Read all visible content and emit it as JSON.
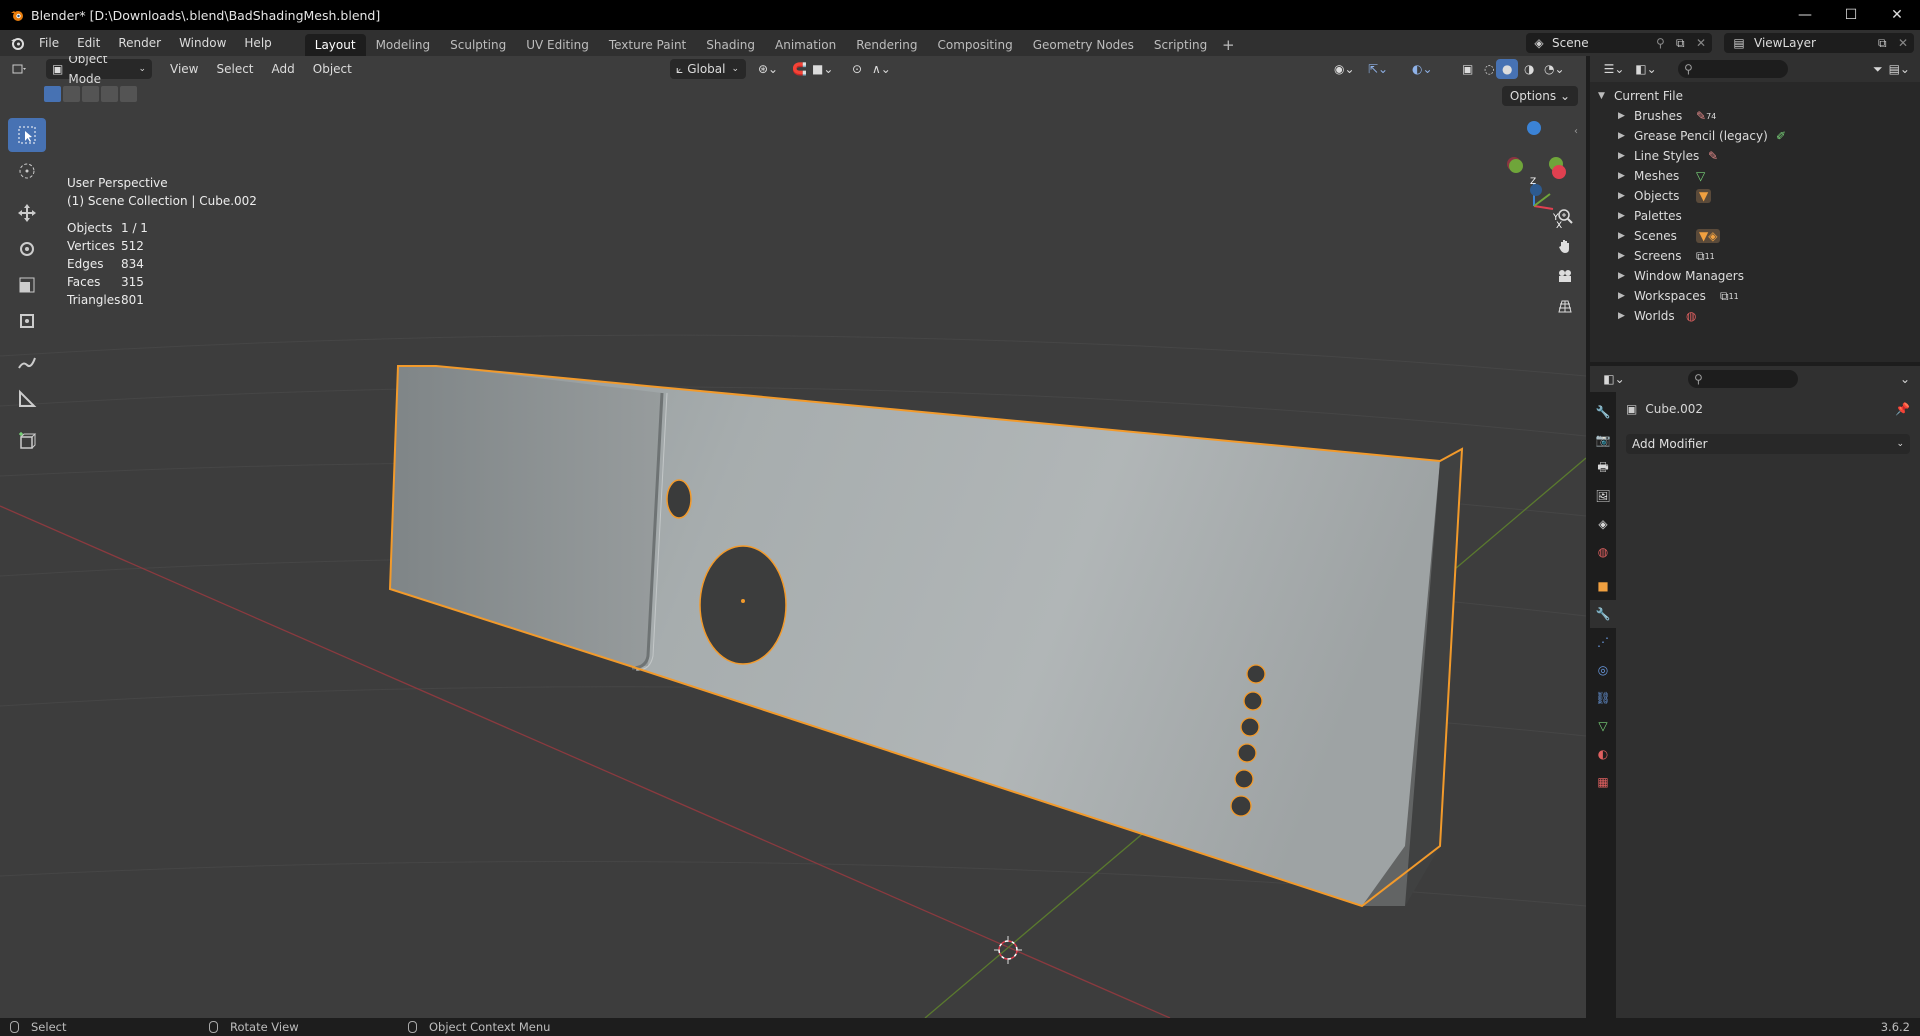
{
  "window": {
    "title": "Blender* [D:\\Downloads\\.blend\\BadShadingMesh.blend]",
    "minimize": "—",
    "maximize": "☐",
    "close": "✕"
  },
  "menu": [
    "File",
    "Edit",
    "Render",
    "Window",
    "Help"
  ],
  "workspaces": [
    "Layout",
    "Modeling",
    "Sculpting",
    "UV Editing",
    "Texture Paint",
    "Shading",
    "Animation",
    "Rendering",
    "Compositing",
    "Geometry Nodes",
    "Scripting"
  ],
  "active_workspace": "Layout",
  "scene_name": "Scene",
  "view_layer_name": "ViewLayer",
  "viewport": {
    "mode": "Object Mode",
    "menus": [
      "View",
      "Select",
      "Add",
      "Object"
    ],
    "transform_orientation": "Global",
    "options_label": "Options",
    "perspective_label": "User Perspective",
    "collection_label": "(1) Scene Collection | Cube.002",
    "stats": [
      {
        "label": "Objects",
        "value": "1 / 1"
      },
      {
        "label": "Vertices",
        "value": "512"
      },
      {
        "label": "Edges",
        "value": "834"
      },
      {
        "label": "Faces",
        "value": "315"
      },
      {
        "label": "Triangles",
        "value": "801"
      }
    ],
    "gizmo_axes": {
      "x": "X",
      "y": "Y",
      "z": "Z"
    }
  },
  "outliner": {
    "root": "Current File",
    "items": [
      {
        "label": "Brushes",
        "badge": "74"
      },
      {
        "label": "Grease Pencil (legacy)",
        "badge": ""
      },
      {
        "label": "Line Styles",
        "badge": ""
      },
      {
        "label": "Meshes",
        "badge": ""
      },
      {
        "label": "Objects",
        "badge": ""
      },
      {
        "label": "Palettes",
        "badge": ""
      },
      {
        "label": "Scenes",
        "badge": ""
      },
      {
        "label": "Screens",
        "badge": "11"
      },
      {
        "label": "Window Managers",
        "badge": ""
      },
      {
        "label": "Workspaces",
        "badge": "11"
      },
      {
        "label": "Worlds",
        "badge": ""
      }
    ]
  },
  "properties": {
    "object_name": "Cube.002",
    "add_modifier_label": "Add Modifier"
  },
  "statusbar": {
    "select": "Select",
    "rotate": "Rotate View",
    "context": "Object Context Menu",
    "version": "3.6.2"
  },
  "colors": {
    "accent": "#4772b3",
    "selection_outline": "#f29a2b",
    "axis_x": "#e04050",
    "axis_y": "#6fa53a",
    "axis_z": "#3b83d6"
  }
}
